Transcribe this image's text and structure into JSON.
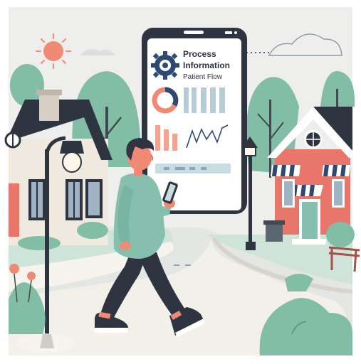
{
  "phone": {
    "title_line1": "Process",
    "title_line2": "Information",
    "subtitle": "Patient Flow"
  },
  "colors": {
    "background": "#eeeeec",
    "tree_green": "#82bda5",
    "house_coral": "#e9766a",
    "house_cream": "#efe9df",
    "roof_dark": "#2f3441",
    "path": "#f7f4ee",
    "shirt": "#86bfae",
    "pants": "#2f3441",
    "sun": "#f08a74",
    "accent_blue": "#2f4a72"
  },
  "icons": [
    "sun-icon",
    "gear-icon",
    "streetlamp-icon",
    "bench-icon",
    "trash-can-icon",
    "cloud-icon"
  ]
}
